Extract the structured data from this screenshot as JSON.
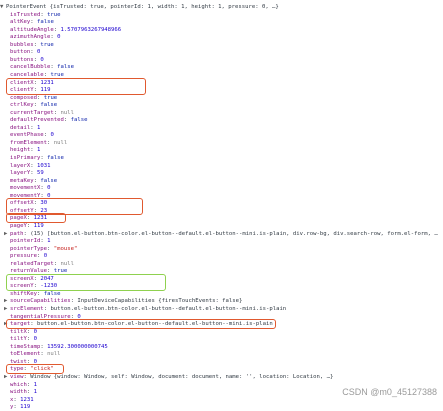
{
  "highlight_colors": {
    "red": "#e0592f",
    "green": "#8fd14f"
  },
  "watermark": "CSDN @m0_45127388",
  "lines": [
    {
      "indent": 0,
      "expand": "▼",
      "key": "PointerEvent",
      "sep": " ",
      "value": "{isTrusted: true, pointerId: 1, width: 1, height: 1, pressure: 0, …}",
      "vtype": "obj"
    },
    {
      "indent": 10,
      "key": "isTrusted",
      "sep": ": ",
      "value": "true",
      "vtype": "bool"
    },
    {
      "indent": 10,
      "key": "altKey",
      "sep": ": ",
      "value": "false",
      "vtype": "bool"
    },
    {
      "indent": 10,
      "key": "altitudeAngle",
      "sep": ": ",
      "value": "1.5707963267948966",
      "vtype": "num"
    },
    {
      "indent": 10,
      "key": "azimuthAngle",
      "sep": ": ",
      "value": "0",
      "vtype": "num"
    },
    {
      "indent": 10,
      "key": "bubbles",
      "sep": ": ",
      "value": "true",
      "vtype": "bool"
    },
    {
      "indent": 10,
      "key": "button",
      "sep": ": ",
      "value": "0",
      "vtype": "num"
    },
    {
      "indent": 10,
      "key": "buttons",
      "sep": ": ",
      "value": "0",
      "vtype": "num"
    },
    {
      "indent": 10,
      "key": "cancelBubble",
      "sep": ": ",
      "value": "false",
      "vtype": "bool"
    },
    {
      "indent": 10,
      "key": "cancelable",
      "sep": ": ",
      "value": "true",
      "vtype": "bool"
    },
    {
      "indent": 10,
      "key": "clientX",
      "sep": ": ",
      "value": "1231",
      "vtype": "num"
    },
    {
      "indent": 10,
      "key": "clientY",
      "sep": ": ",
      "value": "119",
      "vtype": "num"
    },
    {
      "indent": 10,
      "key": "composed",
      "sep": ": ",
      "value": "true",
      "vtype": "bool"
    },
    {
      "indent": 10,
      "key": "ctrlKey",
      "sep": ": ",
      "value": "false",
      "vtype": "bool"
    },
    {
      "indent": 10,
      "key": "currentTarget",
      "sep": ": ",
      "value": "null",
      "vtype": "null"
    },
    {
      "indent": 10,
      "key": "defaultPrevented",
      "sep": ": ",
      "value": "false",
      "vtype": "bool"
    },
    {
      "indent": 10,
      "key": "detail",
      "sep": ": ",
      "value": "1",
      "vtype": "num"
    },
    {
      "indent": 10,
      "key": "eventPhase",
      "sep": ": ",
      "value": "0",
      "vtype": "num"
    },
    {
      "indent": 10,
      "key": "fromElement",
      "sep": ": ",
      "value": "null",
      "vtype": "null"
    },
    {
      "indent": 10,
      "key": "height",
      "sep": ": ",
      "value": "1",
      "vtype": "num"
    },
    {
      "indent": 10,
      "key": "isPrimary",
      "sep": ": ",
      "value": "false",
      "vtype": "bool"
    },
    {
      "indent": 10,
      "key": "layerX",
      "sep": ": ",
      "value": "1031",
      "vtype": "num"
    },
    {
      "indent": 10,
      "key": "layerY",
      "sep": ": ",
      "value": "59",
      "vtype": "num"
    },
    {
      "indent": 10,
      "key": "metaKey",
      "sep": ": ",
      "value": "false",
      "vtype": "bool"
    },
    {
      "indent": 10,
      "key": "movementX",
      "sep": ": ",
      "value": "0",
      "vtype": "num"
    },
    {
      "indent": 10,
      "key": "movementY",
      "sep": ": ",
      "value": "0",
      "vtype": "num"
    },
    {
      "indent": 10,
      "key": "offsetX",
      "sep": ": ",
      "value": "30",
      "vtype": "num"
    },
    {
      "indent": 10,
      "key": "offsetY",
      "sep": ": ",
      "value": "23",
      "vtype": "num"
    },
    {
      "indent": 10,
      "key": "pageX",
      "sep": ": ",
      "value": "1231",
      "vtype": "num"
    },
    {
      "indent": 10,
      "key": "pageY",
      "sep": ": ",
      "value": "119",
      "vtype": "num"
    },
    {
      "indent": 4,
      "expand": "▶",
      "key": "path",
      "sep": ": ",
      "value": "(15) [button.el-button.btn-color.el-button--default.el-button--mini.is-plain, div.row-bg, div.search-row, form.el-form, …",
      "vtype": "obj"
    },
    {
      "indent": 10,
      "key": "pointerId",
      "sep": ": ",
      "value": "1",
      "vtype": "num"
    },
    {
      "indent": 10,
      "key": "pointerType",
      "sep": ": ",
      "value": "\"mouse\"",
      "vtype": "str"
    },
    {
      "indent": 10,
      "key": "pressure",
      "sep": ": ",
      "value": "0",
      "vtype": "num"
    },
    {
      "indent": 10,
      "key": "relatedTarget",
      "sep": ": ",
      "value": "null",
      "vtype": "null"
    },
    {
      "indent": 10,
      "key": "returnValue",
      "sep": ": ",
      "value": "true",
      "vtype": "bool"
    },
    {
      "indent": 10,
      "key": "screenX",
      "sep": ": ",
      "value": "2047",
      "vtype": "num"
    },
    {
      "indent": 10,
      "key": "screenY",
      "sep": ": ",
      "value": "-1230",
      "vtype": "num"
    },
    {
      "indent": 10,
      "key": "shiftKey",
      "sep": ": ",
      "value": "false",
      "vtype": "bool"
    },
    {
      "indent": 4,
      "expand": "▶",
      "key": "sourceCapabilities",
      "sep": ": ",
      "value": "InputDeviceCapabilities {firesTouchEvents: false}",
      "vtype": "obj"
    },
    {
      "indent": 4,
      "expand": "▶",
      "key": "srcElement",
      "sep": ": ",
      "value": "button.el-button.btn-color.el-button--default.el-button--mini.is-plain",
      "vtype": "obj"
    },
    {
      "indent": 10,
      "key": "tangentialPressure",
      "sep": ": ",
      "value": "0",
      "vtype": "num"
    },
    {
      "indent": 4,
      "expand": "▶",
      "key": "target",
      "sep": ": ",
      "value": "button.el-button.btn-color.el-button--default.el-button--mini.is-plain",
      "vtype": "obj"
    },
    {
      "indent": 10,
      "key": "tiltX",
      "sep": ": ",
      "value": "0",
      "vtype": "num"
    },
    {
      "indent": 10,
      "key": "tiltY",
      "sep": ": ",
      "value": "0",
      "vtype": "num"
    },
    {
      "indent": 10,
      "key": "timeStamp",
      "sep": ": ",
      "value": "13592.300000000745",
      "vtype": "num"
    },
    {
      "indent": 10,
      "key": "toElement",
      "sep": ": ",
      "value": "null",
      "vtype": "null"
    },
    {
      "indent": 10,
      "key": "twist",
      "sep": ": ",
      "value": "0",
      "vtype": "num"
    },
    {
      "indent": 10,
      "key": "type",
      "sep": ": ",
      "value": "\"click\"",
      "vtype": "str"
    },
    {
      "indent": 4,
      "expand": "▶",
      "key": "view",
      "sep": ": ",
      "value": "Window {window: Window, self: Window, document: document, name: '', location: Location, …}",
      "vtype": "obj"
    },
    {
      "indent": 10,
      "key": "which",
      "sep": ": ",
      "value": "1",
      "vtype": "num"
    },
    {
      "indent": 10,
      "key": "width",
      "sep": ": ",
      "value": "1",
      "vtype": "num"
    },
    {
      "indent": 10,
      "key": "x",
      "sep": ": ",
      "value": "1231",
      "vtype": "num"
    },
    {
      "indent": 10,
      "key": "y",
      "sep": ": ",
      "value": "119",
      "vtype": "num"
    }
  ],
  "highlights": [
    {
      "name": "highlight-clientXY",
      "from": 10,
      "to": 11,
      "color": "red",
      "width": 140
    },
    {
      "name": "highlight-offsetXY",
      "from": 26,
      "to": 27,
      "color": "red",
      "width": 137
    },
    {
      "name": "highlight-pageX",
      "from": 28,
      "to": 28,
      "color": "red",
      "width": 60
    },
    {
      "name": "highlight-screenXY",
      "from": 36,
      "to": 37,
      "color": "green",
      "width": 160
    },
    {
      "name": "highlight-target",
      "from": 42,
      "to": 42,
      "color": "red",
      "width": 270
    },
    {
      "name": "highlight-type",
      "from": 48,
      "to": 48,
      "color": "red",
      "width": 58
    }
  ]
}
